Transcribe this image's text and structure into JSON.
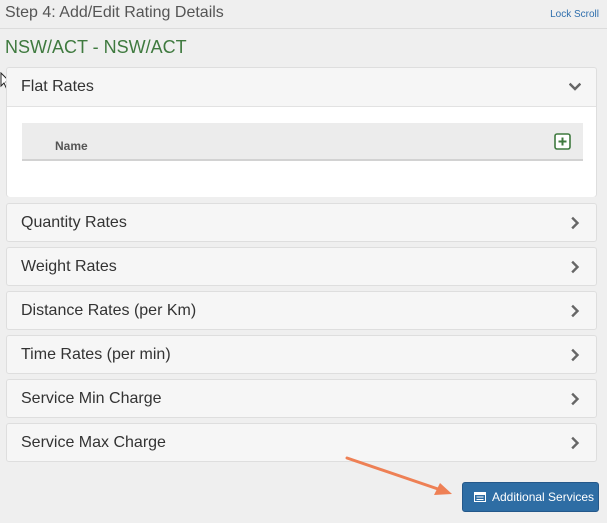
{
  "header": {
    "step_title": "Step 4: Add/Edit Rating Details",
    "lock_scroll_label": "Lock Scroll"
  },
  "route_title": "NSW/ACT - NSW/ACT",
  "flat_rates": {
    "title": "Flat Rates",
    "expanded": true,
    "icon": "chevron-down-icon",
    "table": {
      "columns": [
        "Name"
      ],
      "add_icon": "plus-square-icon"
    }
  },
  "collapsed_panels": [
    {
      "title": "Quantity Rates",
      "icon": "chevron-right-icon"
    },
    {
      "title": "Weight Rates",
      "icon": "chevron-right-icon"
    },
    {
      "title": "Distance Rates (per Km)",
      "icon": "chevron-right-icon"
    },
    {
      "title": "Time Rates (per min)",
      "icon": "chevron-right-icon"
    },
    {
      "title": "Service Min Charge",
      "icon": "chevron-right-icon"
    },
    {
      "title": "Service Max Charge",
      "icon": "chevron-right-icon"
    }
  ],
  "additional_services_button": {
    "label": "Additional Services",
    "icon": "list-icon"
  },
  "colors": {
    "route_title": "#3f7a3f",
    "link": "#2f6fad",
    "primary_button": "#2e6da4",
    "annotation_arrow": "#ee8055",
    "add_icon": "#3f7a3f"
  }
}
